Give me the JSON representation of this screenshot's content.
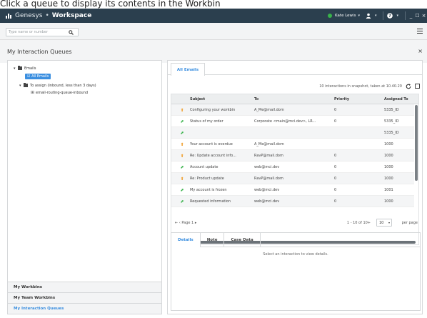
{
  "caption": "Click a queue to display its contents in the Workbin",
  "app": {
    "brand": "Genesys",
    "separator": "•",
    "workspace": "Workspace",
    "user_name": "Kate Lewis",
    "caret": "▾",
    "status_color": "#38b34a",
    "window_buttons": [
      "_",
      "☐",
      "×"
    ]
  },
  "search": {
    "placeholder": "Type name or number"
  },
  "view": {
    "title": "My Interaction Queues",
    "close": "×"
  },
  "tree": {
    "root_label": "Emails",
    "selected_label": "All Emails",
    "folder_label": "To assign (inbound, less than 3 days)",
    "queue_label": "email-routing-queue-inbound"
  },
  "nav": {
    "items": [
      "My Workbins",
      "My Team Workbins",
      "My Interaction Queues"
    ]
  },
  "main": {
    "tab_label": "All Emails",
    "snapshot": "10 interactions in snapshot, taken at 10.40.20",
    "columns": [
      "Subject",
      "To",
      "Priority",
      "Assigned To"
    ],
    "rows": [
      {
        "icon": "inbound",
        "subject": "Configuring your workbin",
        "to": "A_Me@mail.dom",
        "priority": "0",
        "assigned": "5335_ID"
      },
      {
        "icon": "outbound",
        "subject": "Status of my order",
        "to": "Corporate <main@mci.dev>, LR...",
        "priority": "0",
        "assigned": "5335_ID"
      },
      {
        "icon": "outbound",
        "subject": "",
        "to": "",
        "priority": "",
        "assigned": "5335_ID"
      },
      {
        "icon": "inbound",
        "subject": "Your account is overdue",
        "to": "A_Me@mail.dom",
        "priority": "",
        "assigned": "1000"
      },
      {
        "icon": "inbound",
        "subject": "Re: Update account info...",
        "to": "RavP@mail.dom",
        "priority": "0",
        "assigned": "1000"
      },
      {
        "icon": "outbound",
        "subject": "Account update",
        "to": "web@mci.dev",
        "priority": "0",
        "assigned": "1000"
      },
      {
        "icon": "inbound",
        "subject": "Re: Product update",
        "to": "RavP@mail.dom",
        "priority": "0",
        "assigned": "1000"
      },
      {
        "icon": "outbound",
        "subject": "My account is frozen",
        "to": "web@mci.dev",
        "priority": "0",
        "assigned": "1001"
      },
      {
        "icon": "outbound",
        "subject": "Requested information",
        "to": "web@mci.dev",
        "priority": "0",
        "assigned": "1000"
      }
    ],
    "icon_colors": {
      "inbound": "#f0a030",
      "outbound": "#38b34a"
    },
    "pager_nav": "⇤  ‹ Page 1 ▸",
    "pager_range": "1 - 10 of 10+",
    "page_size": "10",
    "per_page": "per page"
  },
  "details": {
    "tabs": [
      "Details",
      "Note",
      "Case Data"
    ],
    "message": "Select an interaction to view details."
  }
}
